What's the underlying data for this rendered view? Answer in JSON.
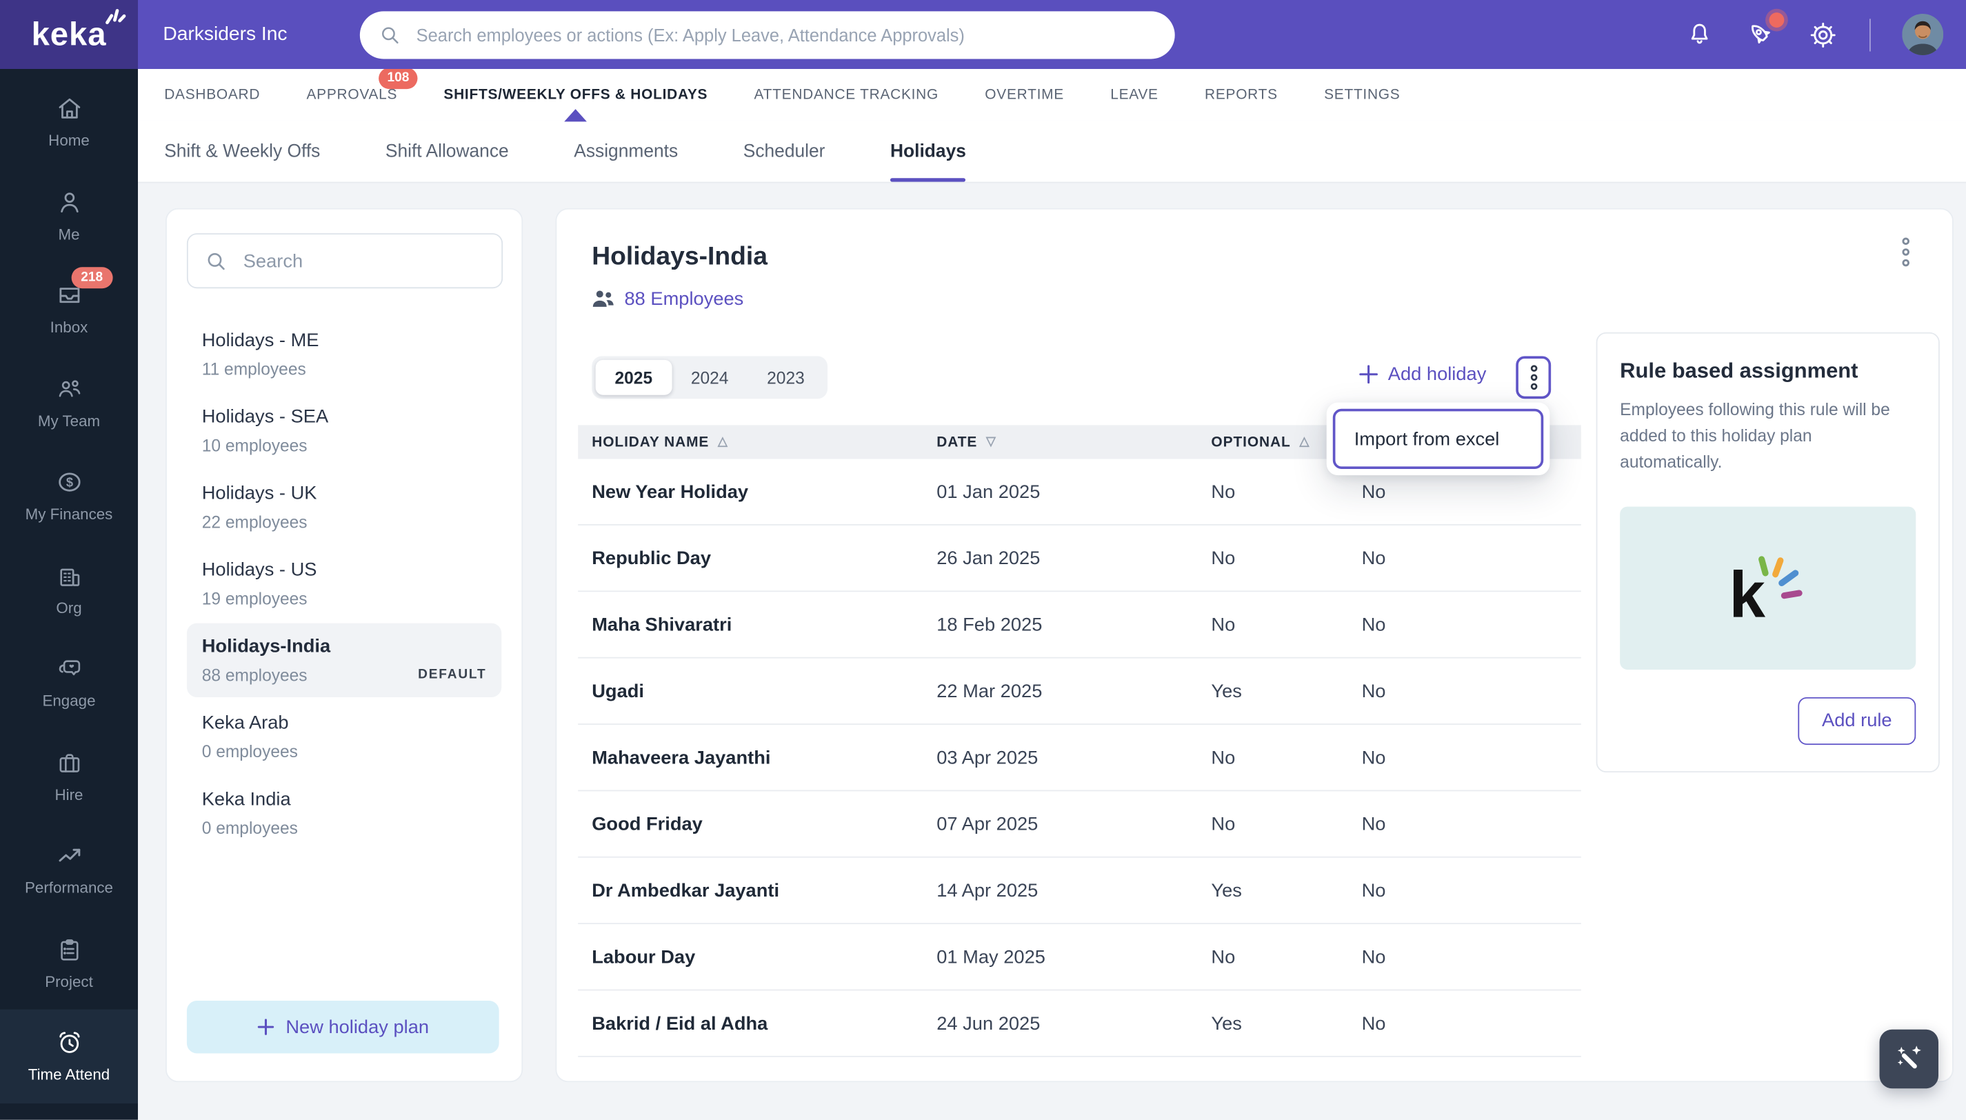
{
  "topbar": {
    "logo_text": "keka",
    "company_name": "Darksiders Inc",
    "search_placeholder": "Search employees or actions (Ex: Apply Leave, Attendance Approvals)"
  },
  "sidebar": {
    "items": [
      {
        "label": "Home",
        "icon": "home-icon"
      },
      {
        "label": "Me",
        "icon": "user-icon"
      },
      {
        "label": "Inbox",
        "icon": "inbox-icon",
        "badge": "218"
      },
      {
        "label": "My Team",
        "icon": "team-icon"
      },
      {
        "label": "My Finances",
        "icon": "finances-icon"
      },
      {
        "label": "Org",
        "icon": "org-icon"
      },
      {
        "label": "Engage",
        "icon": "engage-icon"
      },
      {
        "label": "Hire",
        "icon": "briefcase-icon"
      },
      {
        "label": "Performance",
        "icon": "trend-icon"
      },
      {
        "label": "Project",
        "icon": "clipboard-icon"
      },
      {
        "label": "Time Attend",
        "icon": "alarm-clock-icon",
        "active": true
      }
    ]
  },
  "nav": {
    "tabs": [
      {
        "label": "DASHBOARD"
      },
      {
        "label": "APPROVALS",
        "badge": "108"
      },
      {
        "label": "SHIFTS/WEEKLY OFFS & HOLIDAYS",
        "active": true
      },
      {
        "label": "ATTENDANCE TRACKING"
      },
      {
        "label": "OVERTIME"
      },
      {
        "label": "LEAVE"
      },
      {
        "label": "REPORTS"
      },
      {
        "label": "SETTINGS"
      }
    ]
  },
  "subnav": {
    "tabs": [
      {
        "label": "Shift & Weekly Offs"
      },
      {
        "label": "Shift Allowance"
      },
      {
        "label": "Assignments"
      },
      {
        "label": "Scheduler"
      },
      {
        "label": "Holidays",
        "active": true
      }
    ]
  },
  "plans_panel": {
    "search_placeholder": "Search",
    "plans": [
      {
        "name": "Holidays - ME",
        "employees": "11 employees"
      },
      {
        "name": "Holidays - SEA",
        "employees": "10 employees"
      },
      {
        "name": "Holidays - UK",
        "employees": "22 employees"
      },
      {
        "name": "Holidays - US",
        "employees": "19 employees"
      },
      {
        "name": "Holidays-India",
        "employees": "88 employees",
        "badge": "DEFAULT",
        "selected": true
      },
      {
        "name": "Keka Arab",
        "employees": "0 employees"
      },
      {
        "name": "Keka India",
        "employees": "0 employees"
      }
    ],
    "new_plan_label": "New holiday plan"
  },
  "main": {
    "title": "Holidays-India",
    "employees_link": "88 Employees",
    "year_tabs": [
      {
        "label": "2025",
        "active": true
      },
      {
        "label": "2024"
      },
      {
        "label": "2023"
      }
    ],
    "add_holiday_label": "Add holiday",
    "menu_items": [
      {
        "label": "Import from excel"
      }
    ],
    "table": {
      "columns": [
        {
          "label": "HOLIDAY NAME",
          "sort_icon": "△"
        },
        {
          "label": "DATE",
          "sort_icon": "▽"
        },
        {
          "label": "OPTIONAL",
          "sort_icon": "△"
        }
      ],
      "rows": [
        {
          "name": "New Year Holiday",
          "date": "01 Jan 2025",
          "optional": "No",
          "col4": "No"
        },
        {
          "name": "Republic Day",
          "date": "26 Jan 2025",
          "optional": "No",
          "col4": "No"
        },
        {
          "name": "Maha Shivaratri",
          "date": "18 Feb 2025",
          "optional": "No",
          "col4": "No"
        },
        {
          "name": "Ugadi",
          "date": "22 Mar 2025",
          "optional": "Yes",
          "col4": "No"
        },
        {
          "name": "Mahaveera Jayanthi",
          "date": "03 Apr 2025",
          "optional": "No",
          "col4": "No"
        },
        {
          "name": "Good Friday",
          "date": "07 Apr 2025",
          "optional": "No",
          "col4": "No"
        },
        {
          "name": "Dr Ambedkar Jayanti",
          "date": "14 Apr 2025",
          "optional": "Yes",
          "col4": "No"
        },
        {
          "name": "Labour Day",
          "date": "01 May 2025",
          "optional": "No",
          "col4": "No"
        },
        {
          "name": "Bakrid / Eid al Adha",
          "date": "24 Jun 2025",
          "optional": "Yes",
          "col4": "No"
        }
      ]
    }
  },
  "rule_panel": {
    "title": "Rule based assignment",
    "description": "Employees following this rule will be added to this holiday plan automatically.",
    "button_label": "Add rule",
    "logo_letter": "k"
  },
  "colors": {
    "topbar_purple": "#5a4fbe",
    "logo_block_purple": "#3e3487",
    "accent_purple": "#5b50c0",
    "sidebar_navy": "#15202e",
    "badge_red": "#ec6a60",
    "new_plan_bg": "#d8f0f9",
    "rule_image_bg": "#e1eff0",
    "page_bg": "#f2f4f7"
  }
}
